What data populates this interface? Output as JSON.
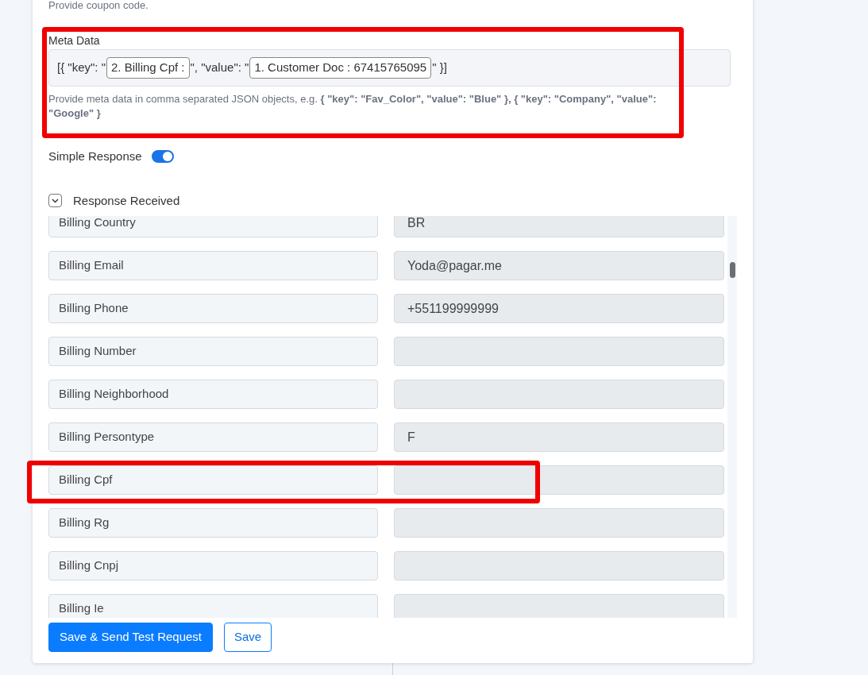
{
  "coupon_hint": "Provide coupon code.",
  "meta_data": {
    "label": "Meta Data",
    "parts": [
      {
        "kind": "text",
        "text": "[{ \"key\": \""
      },
      {
        "kind": "token",
        "text": "2. Billing Cpf :"
      },
      {
        "kind": "text",
        "text": "\", \"value\": \""
      },
      {
        "kind": "token",
        "text": "1. Customer Doc : 67415765095"
      },
      {
        "kind": "text",
        "text": "\" }]"
      }
    ],
    "hint": "Provide meta data in comma separated JSON objects, e.g. **{ \"key\": \"Fav_Color\", \"value\": \"Blue\" }, { \"key\": \"Company\", \"value\": \"Google\" }**"
  },
  "simple_response": {
    "label": "Simple Response",
    "on": true
  },
  "response_received": {
    "label": "Response Received",
    "expanded": true
  },
  "rows": [
    {
      "label": "Billing Country",
      "value": "BR"
    },
    {
      "label": "Billing Email",
      "value": "Yoda@pagar.me"
    },
    {
      "label": "Billing Phone",
      "value": "+551199999999"
    },
    {
      "label": "Billing Number",
      "value": ""
    },
    {
      "label": "Billing Neighborhood",
      "value": ""
    },
    {
      "label": "Billing Persontype",
      "value": "F"
    },
    {
      "label": "Billing Cpf",
      "value": ""
    },
    {
      "label": "Billing Rg",
      "value": ""
    },
    {
      "label": "Billing Cnpj",
      "value": ""
    },
    {
      "label": "Billing Ie",
      "value": ""
    }
  ],
  "buttons": [
    {
      "kind": "primary",
      "label": "Save & Send Test Request"
    },
    {
      "kind": "outline",
      "label": "Save"
    }
  ]
}
